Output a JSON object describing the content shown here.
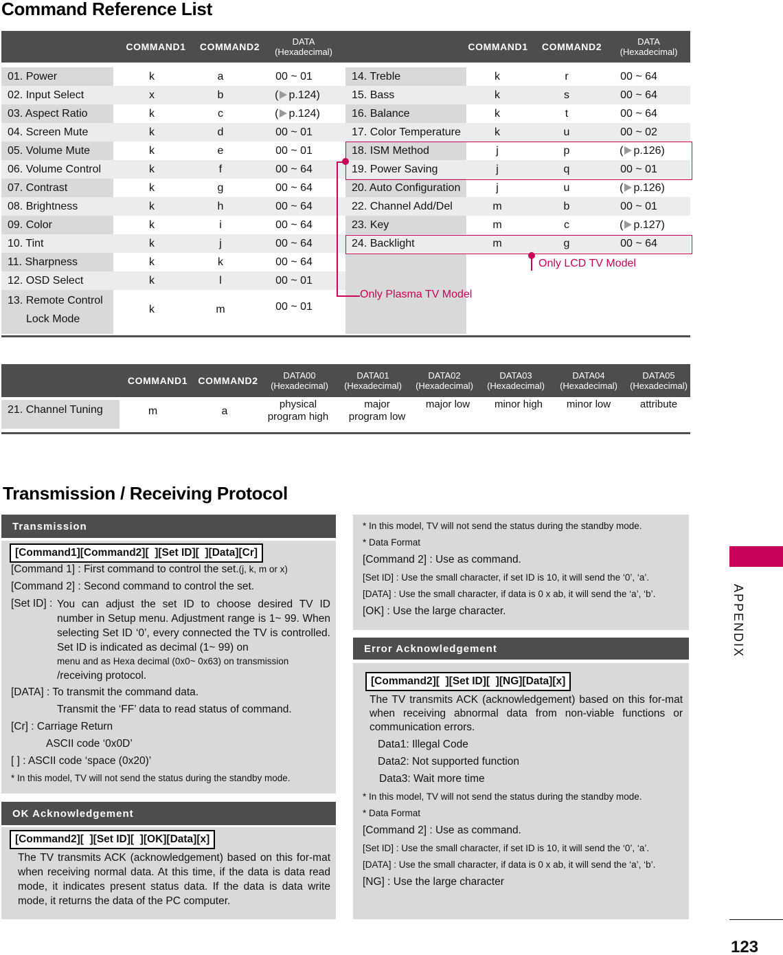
{
  "page": {
    "title": "Command Reference List",
    "section2_title": "Transmission / Receiving  Protocol",
    "side_tab_label": "APPENDIX",
    "page_number": "123",
    "accent_color": "#c8005a",
    "header_color": "#4d4d4d"
  },
  "command_table": {
    "headers": {
      "command1": "COMMAND1",
      "command2": "COMMAND2",
      "data_line1": "DATA",
      "data_line2": "(Hexadecimal)"
    },
    "left_rows": [
      {
        "name": "01. Power",
        "cmd1": "k",
        "cmd2": "a",
        "data": "00 ~ 01"
      },
      {
        "name": "02. Input Select",
        "cmd1": "x",
        "cmd2": "b",
        "data_ref": "p.124"
      },
      {
        "name": "03. Aspect Ratio",
        "cmd1": "k",
        "cmd2": "c",
        "data_ref": "p.124"
      },
      {
        "name": "04. Screen Mute",
        "cmd1": "k",
        "cmd2": "d",
        "data": "00 ~ 01"
      },
      {
        "name": "05. Volume Mute",
        "cmd1": "k",
        "cmd2": "e",
        "data": "00 ~ 01"
      },
      {
        "name": "06. Volume Control",
        "cmd1": "k",
        "cmd2": "f",
        "data": "00 ~ 64"
      },
      {
        "name": "07.  Contrast",
        "cmd1": "k",
        "cmd2": "g",
        "data": "00 ~ 64"
      },
      {
        "name": "08. Brightness",
        "cmd1": "k",
        "cmd2": "h",
        "data": "00 ~ 64"
      },
      {
        "name": "09. Color",
        "cmd1": "k",
        "cmd2": "i",
        "data": "00 ~ 64"
      },
      {
        "name": "10.  Tint",
        "cmd1": "k",
        "cmd2": "j",
        "data": "00 ~ 64"
      },
      {
        "name": "11.  Sharpness",
        "cmd1": "k",
        "cmd2": "k",
        "data": "00 ~ 64"
      },
      {
        "name": "12.  OSD Select",
        "cmd1": "k",
        "cmd2": "l",
        "data": "00 ~ 01"
      },
      {
        "name_line1": "13.  Remote Control",
        "name_line2": "Lock Mode",
        "cmd1": "k",
        "cmd2": "m",
        "data": "00 ~ 01"
      }
    ],
    "right_rows": [
      {
        "name": "14.  Treble",
        "cmd1": "k",
        "cmd2": "r",
        "data": "00 ~ 64"
      },
      {
        "name": "15.  Bass",
        "cmd1": "k",
        "cmd2": "s",
        "data": "00 ~ 64"
      },
      {
        "name": "16.  Balance",
        "cmd1": "k",
        "cmd2": "t",
        "data": "00 ~ 64"
      },
      {
        "name": "17.  Color Temperature",
        "cmd1": "k",
        "cmd2": "u",
        "data": "00 ~ 02"
      },
      {
        "name": "18.  ISM Method",
        "cmd1": "j",
        "cmd2": "p",
        "data_ref": "p.126"
      },
      {
        "name": "19.  Power Saving",
        "cmd1": "j",
        "cmd2": "q",
        "data": "00 ~ 01"
      },
      {
        "name": "20. Auto Configuration",
        "cmd1": "j",
        "cmd2": "u",
        "data_ref": "p.126"
      },
      {
        "name": "22. Channel Add/Del",
        "cmd1": "m",
        "cmd2": "b",
        "data": "00 ~ 01"
      },
      {
        "name": "23. Key",
        "cmd1": "m",
        "cmd2": "c",
        "data_ref": "p.127"
      },
      {
        "name": "24. Backlight",
        "cmd1": "m",
        "cmd2": "g",
        "data": "00 ~ 64"
      }
    ],
    "annotations": {
      "lcd_only": "Only LCD TV Model",
      "plasma_only": "Only Plasma TV Model"
    }
  },
  "channel_tuning_table": {
    "headers": {
      "command1": "COMMAND1",
      "command2": "COMMAND2",
      "data_cols": [
        {
          "name": "DATA00",
          "unit": "(Hexadecimal)"
        },
        {
          "name": "DATA01",
          "unit": "(Hexadecimal)"
        },
        {
          "name": "DATA02",
          "unit": "(Hexadecimal)"
        },
        {
          "name": "DATA03",
          "unit": "(Hexadecimal)"
        },
        {
          "name": "DATA04",
          "unit": "(Hexadecimal)"
        },
        {
          "name": "DATA05",
          "unit": "(Hexadecimal)"
        }
      ]
    },
    "row": {
      "name": "21. Channel Tuning",
      "cmd1": "m",
      "cmd2": "a",
      "values": [
        {
          "line1": "physical",
          "line2": "program high"
        },
        {
          "line1": "major",
          "line2": "program low"
        },
        {
          "line1": "major low",
          "line2": ""
        },
        {
          "line1": "minor high",
          "line2": ""
        },
        {
          "line1": "minor low",
          "line2": ""
        },
        {
          "line1": "attribute",
          "line2": ""
        }
      ]
    }
  },
  "transmission": {
    "title": "Transmission",
    "format": "[Command1][Command2][  ][Set ID][  ][Data][Cr]",
    "cmd1_label": "[Command 1] : First command to control the set.",
    "cmd1_note": "(j, k, m or x)",
    "cmd2_label": "[Command 2] : Second command to control the set.",
    "setid_label": "[Set ID] :",
    "setid_text1": "You can adjust the set ID to choose desired TV ID number in Setup menu. Adjustment range is 1~ 99. When selecting Set ID ‘0’, every connected the TV is controlled. Set ID is indicated as decimal (1~ 99) on",
    "setid_text2": "menu and as Hexa decimal (0x0~ 0x63) on transmission",
    "setid_text3": "/receiving protocol.",
    "data_label": "[DATA] : To transmit the command data.",
    "data_sub": "Transmit the ‘FF’ data to read status of command.",
    "cr_label": "[Cr] : Carriage Return",
    "cr_sub": "ASCII code ‘0x0D’",
    "space_label": "[   ] : ASCII code ‘space (0x20)’",
    "note": "* In this model, TV will not send the status during the standby mode."
  },
  "ok_ack": {
    "title": "OK Acknowledgement",
    "format": "[Command2][  ][Set ID][  ][OK][Data][x]",
    "text": "The TV transmits ACK (acknowledgement) based on this for-mat when receiving normal data. At this time, if the data is data read mode, it indicates present status data. If the data is data write mode, it returns the data of the PC computer."
  },
  "ok_notes": {
    "note1": "* In this model, TV will not send the status during the standby mode.",
    "note2": "* Data Format",
    "cmd2": "[Command 2] : Use as command.",
    "setid": "[Set ID] : Use the small character, if set ID is 10, it will send the ‘0’, ‘a’.",
    "data": "[DATA] : Use the small character, if data is 0 x ab, it will send the ‘a’, ‘b’.",
    "ok": "[OK] : Use the large character."
  },
  "error_ack": {
    "title": "Error Acknowledgement",
    "format": "[Command2][  ][Set ID][  ][NG][Data][x]",
    "text": "The TV transmits ACK (acknowledgement) based on this for-mat when receiving abnormal data from non-viable functions or communication errors.",
    "data1": "Data1: Illegal Code",
    "data2": "Data2: Not supported function",
    "data3": "Data3: Wait more time",
    "note1": "* In this model, TV will not send the status during the standby mode.",
    "note2": "* Data Format",
    "cmd2": "[Command 2] : Use as command.",
    "setid": "[Set ID] : Use the small character, if set ID is 10, it will send the ‘0’, ‘a’.",
    "data": "[DATA] : Use the small character, if data is 0 x ab, it will send the ‘a’, ‘b’.",
    "ng": "[NG] : Use the large character"
  }
}
